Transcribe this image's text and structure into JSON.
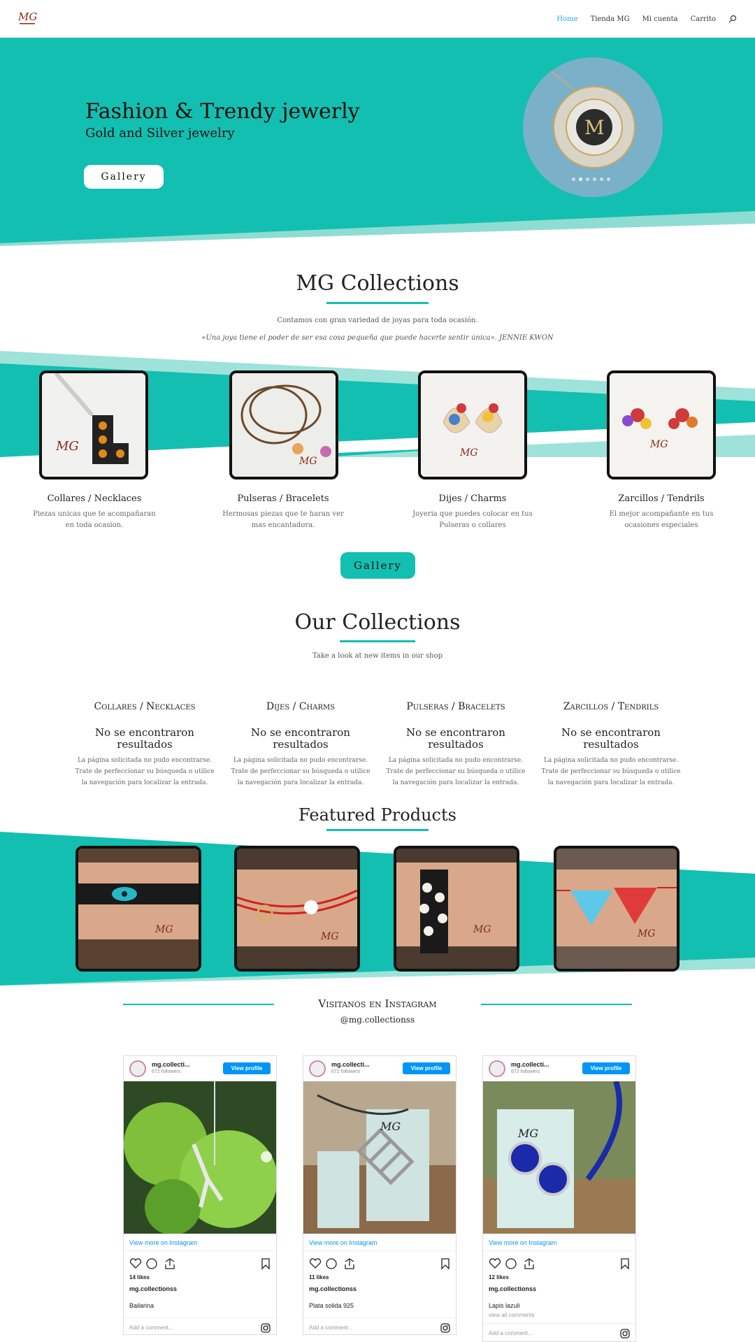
{
  "header": {
    "logo": "mg-logo",
    "nav": [
      "Home",
      "Tienda MG",
      "Mi cuenta",
      "Carrito"
    ],
    "active": "Home",
    "search_icon": "search-icon"
  },
  "hero": {
    "title": "Fashion & Trendy jewerly",
    "subtitle": "Gold and Silver jewelry",
    "button": "Gallery",
    "slides": 6,
    "active_slide": 2,
    "bg_color": "#13bfb0"
  },
  "mg_collections": {
    "title": "MG Collections",
    "text": "Contamos con gran variedad de joyas para toda ocasión.",
    "quote": "«Una joya tiene el poder de ser esa cosa pequeña que puede hacerte sentir única». JENNIE KWON",
    "categories": [
      {
        "title": "Collares / Necklaces",
        "desc": "Piezas unicas que te acompañaran en toda ocasion."
      },
      {
        "title": "Pulseras / Bracelets",
        "desc": "Hermosas piezas que te haran ver mas encantadora."
      },
      {
        "title": "Dijes / Charms",
        "desc": "Joyeria que puedes colocar en tus Pulseras o collares"
      },
      {
        "title": "Zarcillos / Tendrils",
        "desc": "El mejor acompañante en tus ocasiones especiales"
      }
    ],
    "button": "Gallery"
  },
  "our_collections": {
    "title": "Our Collections",
    "subtitle": "Take a look at new items in our shop",
    "columns": [
      {
        "head": "Collares / Necklaces",
        "sub": "No se encontraron resultados",
        "text": "La página solicitada no pudo encontrarse. Trate de perfeccionar su búsqueda o utilice la navegación para localizar la entrada."
      },
      {
        "head": "Dijes / Charms",
        "sub": "No se encontraron resultados",
        "text": "La página solicitada no pudo encontrarse. Trate de perfeccionar su búsqueda o utilice la navegación para localizar la entrada."
      },
      {
        "head": "Pulseras / Bracelets",
        "sub": "No se encontraron resultados",
        "text": "La página solicitada no pudo encontrarse. Trate de perfeccionar su búsqueda o utilice la navegación para localizar la entrada."
      },
      {
        "head": "Zarcillos / Tendrils",
        "sub": "No se encontraron resultados",
        "text": "La página solicitada no pudo encontrarse. Trate de perfeccionar su búsqueda o utilice la navegación para localizar la entrada."
      }
    ]
  },
  "featured": {
    "title": "Featured Products"
  },
  "instagram": {
    "title": "Visitanos en Instagram",
    "handle": "@mg.collectionss",
    "posts": [
      {
        "user": "mg.collecti...",
        "followers": "672 followers",
        "button": "View profile",
        "more": "View more on Instagram",
        "likes": "14 likes",
        "owner": "mg.collectionss",
        "caption": "Bailarina",
        "comments": "",
        "add": "Add a comment..."
      },
      {
        "user": "mg.collecti...",
        "followers": "672 followers",
        "button": "View profile",
        "more": "View more on Instagram",
        "likes": "11 likes",
        "owner": "mg.collectionss",
        "caption": "Plata solida 925",
        "comments": "",
        "add": "Add a comment..."
      },
      {
        "user": "mg.collecti...",
        "followers": "672 followers",
        "button": "View profile",
        "more": "View more on Instagram",
        "likes": "12 likes",
        "owner": "mg.collectionss",
        "caption": "Lapis lazuli",
        "comments": "view all comments",
        "add": "Add a comment..."
      }
    ]
  }
}
